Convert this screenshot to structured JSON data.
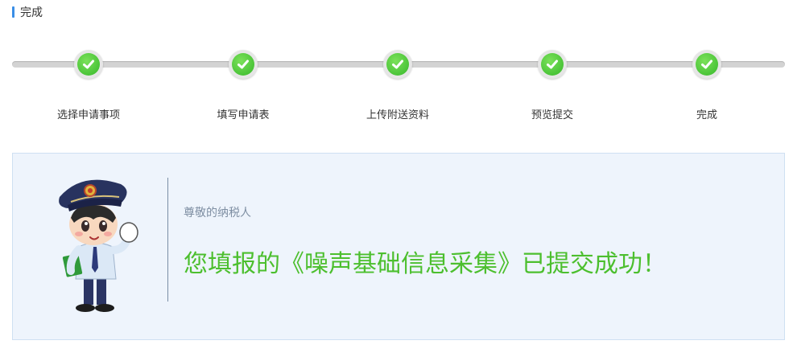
{
  "header": {
    "title": "完成"
  },
  "steps": [
    {
      "label": "选择申请事项",
      "status": "done"
    },
    {
      "label": "填写申请表",
      "status": "done"
    },
    {
      "label": "上传附送资料",
      "status": "done"
    },
    {
      "label": "预览提交",
      "status": "done"
    },
    {
      "label": "完成",
      "status": "done"
    }
  ],
  "result": {
    "greeting": "尊敬的纳税人",
    "message": "您填报的《噪声基础信息采集》已提交成功！"
  },
  "colors": {
    "accent": "#3a8ee6",
    "success": "#4cbf2e",
    "panel_bg": "#eef4fc"
  }
}
